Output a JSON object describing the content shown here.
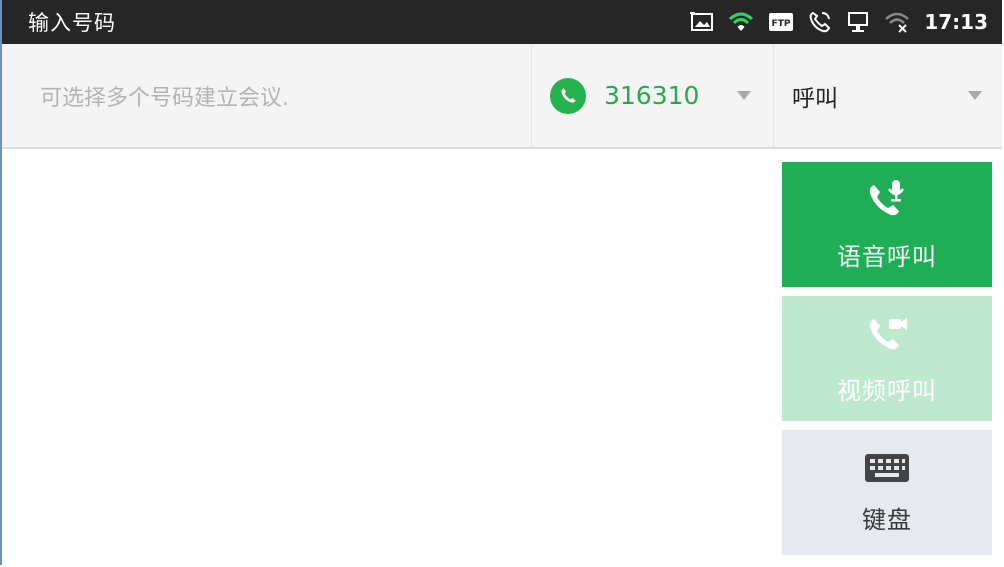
{
  "status_bar": {
    "title": "输入号码",
    "clock": "17:13",
    "icons": [
      "screenshot-icon",
      "wifi-icon",
      "ftp-icon",
      "call-status-icon",
      "network-icon",
      "wifi-off-icon"
    ],
    "ftp_label": "FTP"
  },
  "dial": {
    "placeholder": "可选择多个号码建立会议.",
    "account_number": "316310",
    "mode": "呼叫"
  },
  "actions": {
    "voice_call": "语音呼叫",
    "video_call": "视频呼叫",
    "keypad": "键盘"
  },
  "colors": {
    "accent_green": "#1fae55",
    "disabled_green": "#bfe9cf",
    "status_bar_bg": "#262626"
  }
}
